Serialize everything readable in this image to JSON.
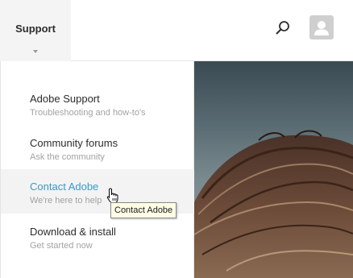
{
  "header": {
    "support_label": "Support",
    "search_icon": "search-icon",
    "avatar_icon": "user-avatar-icon"
  },
  "menu": {
    "items": [
      {
        "title": "Adobe Support",
        "subtitle": "Troubleshooting and how-to's",
        "active": false
      },
      {
        "title": "Community forums",
        "subtitle": "Ask the community",
        "active": false
      },
      {
        "title": "Contact Adobe",
        "subtitle": "We're here to help",
        "active": true
      },
      {
        "title": "Download & install",
        "subtitle": "Get started now",
        "active": false
      }
    ]
  },
  "tooltip": {
    "text": "Contact Adobe"
  },
  "colors": {
    "accent": "#2d9cdb",
    "active_bg": "#f3f3f3",
    "tab_bg": "#f4f4f4"
  }
}
